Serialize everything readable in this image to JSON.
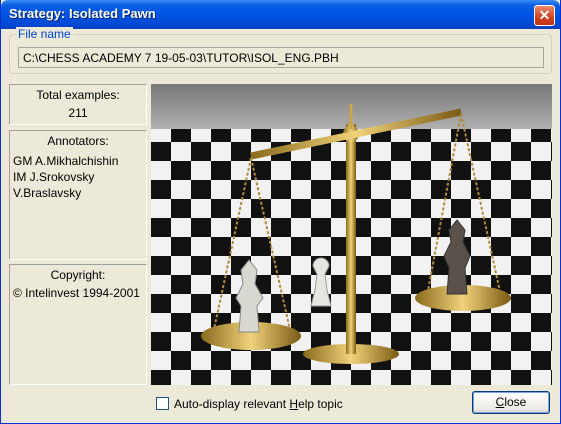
{
  "window": {
    "title": "Strategy: Isolated Pawn",
    "close_symbol": "✕"
  },
  "file_group": {
    "label": "File name",
    "path": "C:\\CHESS ACADEMY 7 19-05-03\\TUTOR\\ISOL_ENG.PBH"
  },
  "total": {
    "label": "Total examples:",
    "value": "211"
  },
  "annotators": {
    "label": "Annotators:",
    "names": [
      "GM A.Mikhalchishin",
      "IM J.Srokovsky",
      "V.Braslavsky"
    ]
  },
  "copyright": {
    "label": "Copyright:",
    "text": "© Intelinvest 1994-2001"
  },
  "footer": {
    "checkbox_label_pre": "Auto-display relevant ",
    "checkbox_label_u": "H",
    "checkbox_label_post": "elp topic",
    "checkbox_checked": false,
    "close_u": "C",
    "close_rest": "lose"
  },
  "image": {
    "subject": "golden balance scale weighing chess pieces on a checkerboard"
  },
  "colors": {
    "title_bar": "#0054e3",
    "dialog_bg": "#ece9d8",
    "close_red": "#d1421f",
    "group_label": "#0046d5"
  }
}
